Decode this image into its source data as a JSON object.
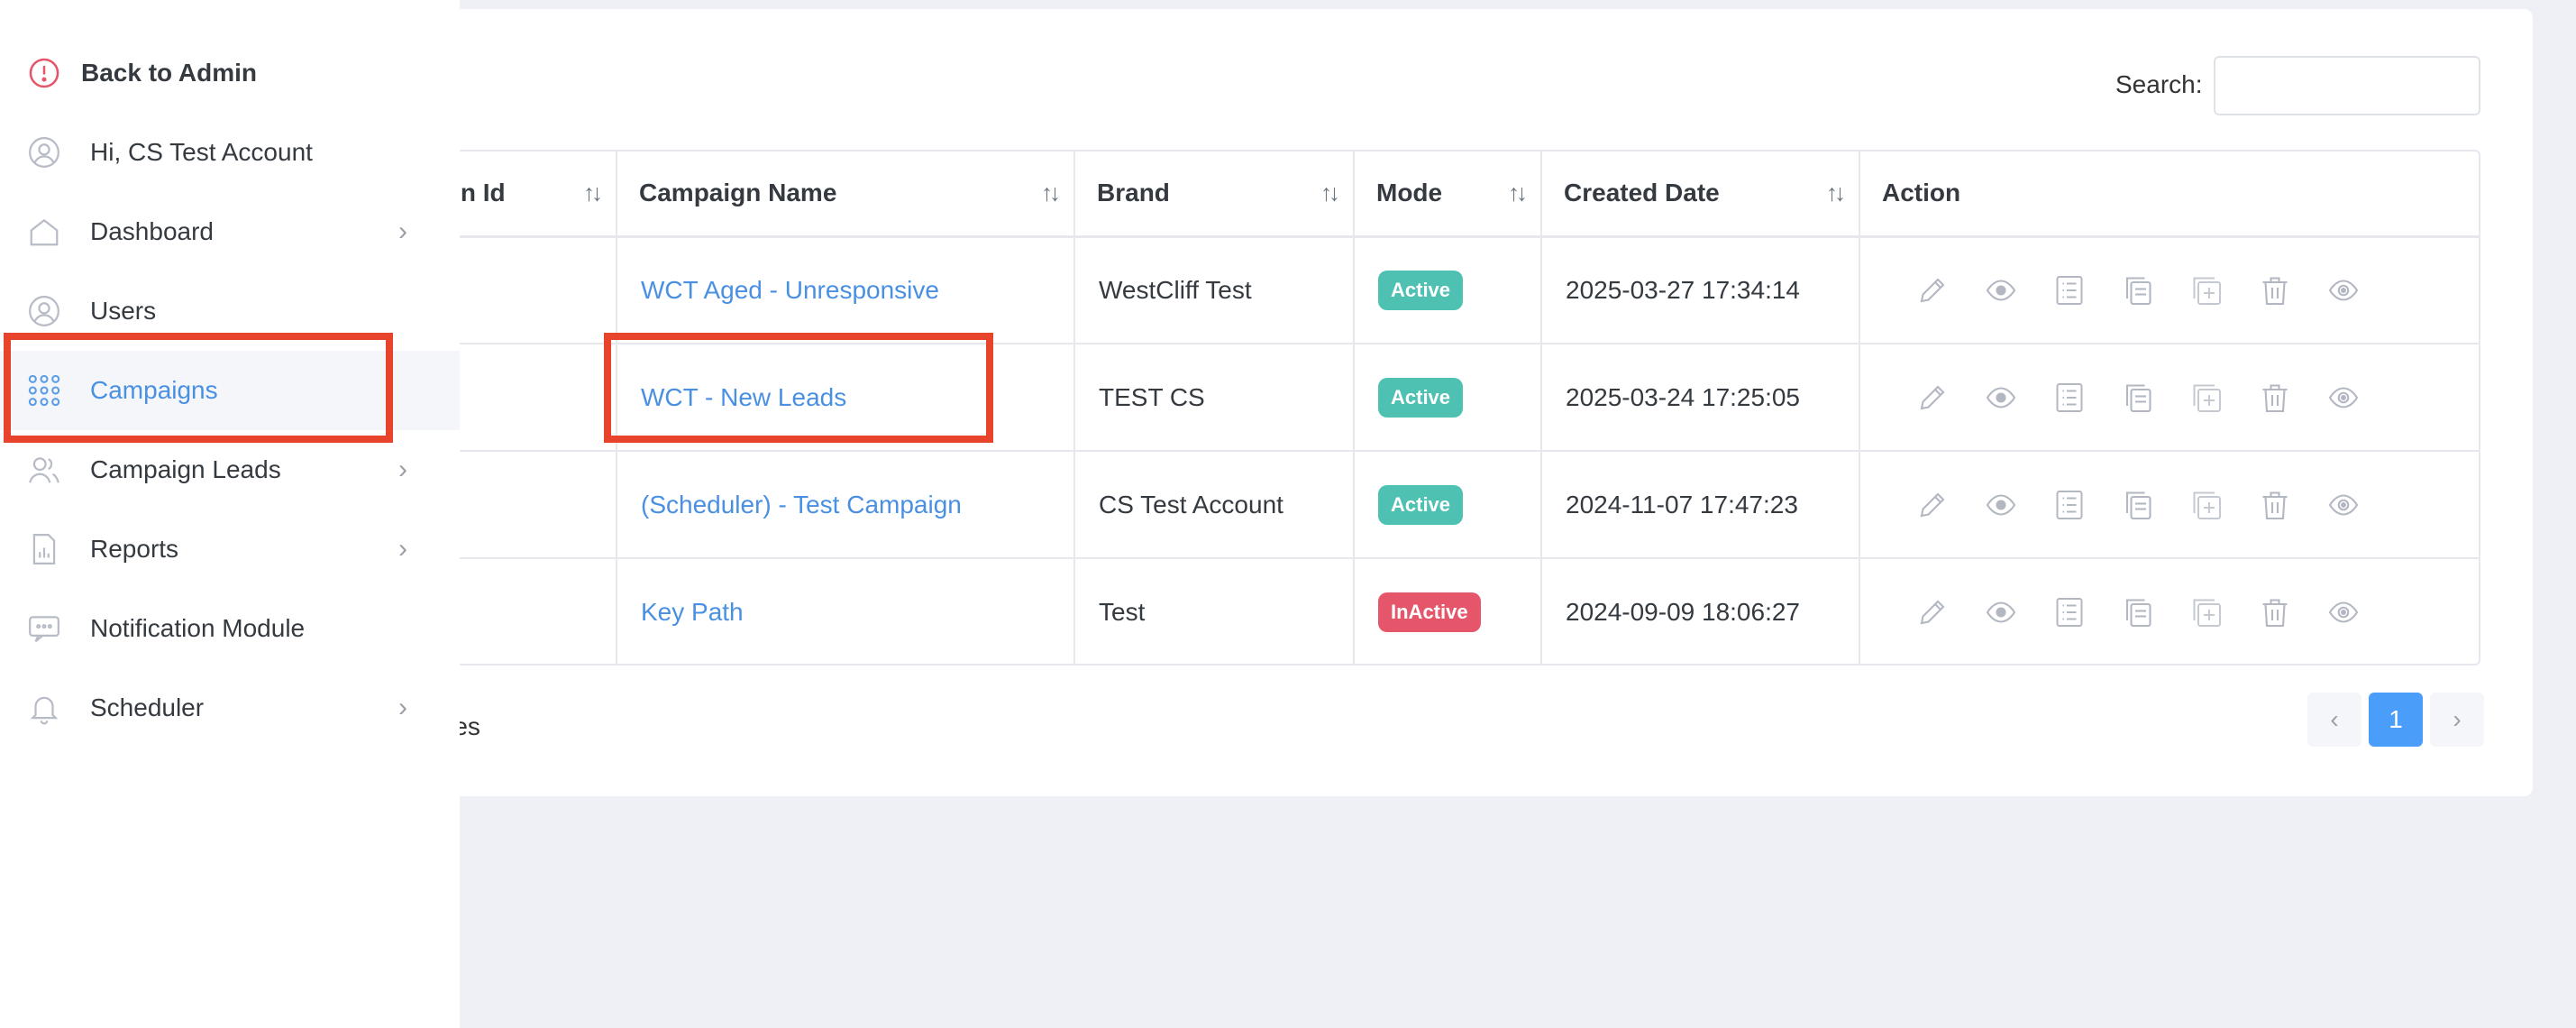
{
  "sidebar": {
    "back_label": "Back to Admin",
    "greeting": "Hi, CS Test Account",
    "items": [
      {
        "label": "Dashboard",
        "icon": "home-icon",
        "has_submenu": true
      },
      {
        "label": "Users",
        "icon": "user-icon",
        "has_submenu": false
      },
      {
        "label": "Campaigns",
        "icon": "grid-icon",
        "has_submenu": false,
        "active": true
      },
      {
        "label": "Campaign Leads",
        "icon": "users-icon",
        "has_submenu": true
      },
      {
        "label": "Reports",
        "icon": "report-icon",
        "has_submenu": true
      },
      {
        "label": "Notification Module",
        "icon": "message-icon",
        "has_submenu": false
      },
      {
        "label": "Scheduler",
        "icon": "bell-icon",
        "has_submenu": true
      }
    ]
  },
  "toolbar": {
    "entries_fragment": "s",
    "search_label": "Search:",
    "search_value": ""
  },
  "table": {
    "headers": [
      "ign Id",
      "Campaign Name",
      "Brand",
      "Mode",
      "Created Date",
      "Action"
    ],
    "rows": [
      {
        "name": "WCT Aged - Unresponsive",
        "brand": "WestCliff Test",
        "mode": "Active",
        "created": "2025-03-27 17:34:14"
      },
      {
        "name": "WCT - New Leads",
        "brand": "TEST CS",
        "mode": "Active",
        "created": "2025-03-24 17:25:05"
      },
      {
        "name": "(Scheduler) - Test Campaign",
        "brand": "CS Test Account",
        "mode": "Active",
        "created": "2024-11-07 17:47:23"
      },
      {
        "name": "Key Path",
        "brand": "Test",
        "mode": "InActive",
        "created": "2024-09-09 18:06:27"
      }
    ],
    "action_icons": [
      "edit-icon",
      "view-icon",
      "list-icon",
      "copy-icon",
      "add-copy-icon",
      "delete-icon",
      "preview-icon"
    ]
  },
  "footer": {
    "showing_fragment": "tries",
    "pagination": {
      "prev": "‹",
      "current": "1",
      "next": "›"
    }
  },
  "colors": {
    "accent": "#4a90e2",
    "active_badge": "#4fc1b2",
    "inactive_badge": "#e5566a",
    "highlight": "#e8432b"
  }
}
